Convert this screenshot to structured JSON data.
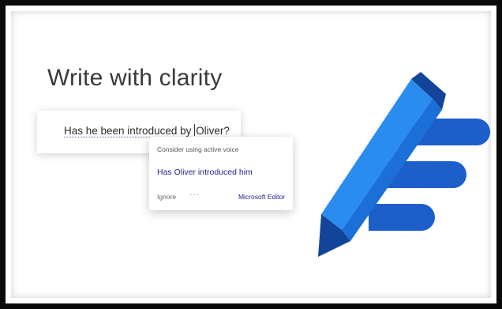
{
  "hero": {
    "title": "Write with clarity"
  },
  "document": {
    "sentence": "Has he been introduced by Oliver?"
  },
  "editor_popup": {
    "hint": "Consider using active voice",
    "suggestion": "Has Oliver introduced him",
    "ignore_label": "Ignore",
    "more_label": "···",
    "brand": "Microsoft Editor"
  },
  "logo": {
    "icon": "microsoft-editor-pen-logo",
    "colors": {
      "pen_light": "#2b8cf0",
      "pen_mid": "#1b6fd6",
      "pen_dark": "#12449a",
      "lines": "#1d5fc9"
    }
  }
}
